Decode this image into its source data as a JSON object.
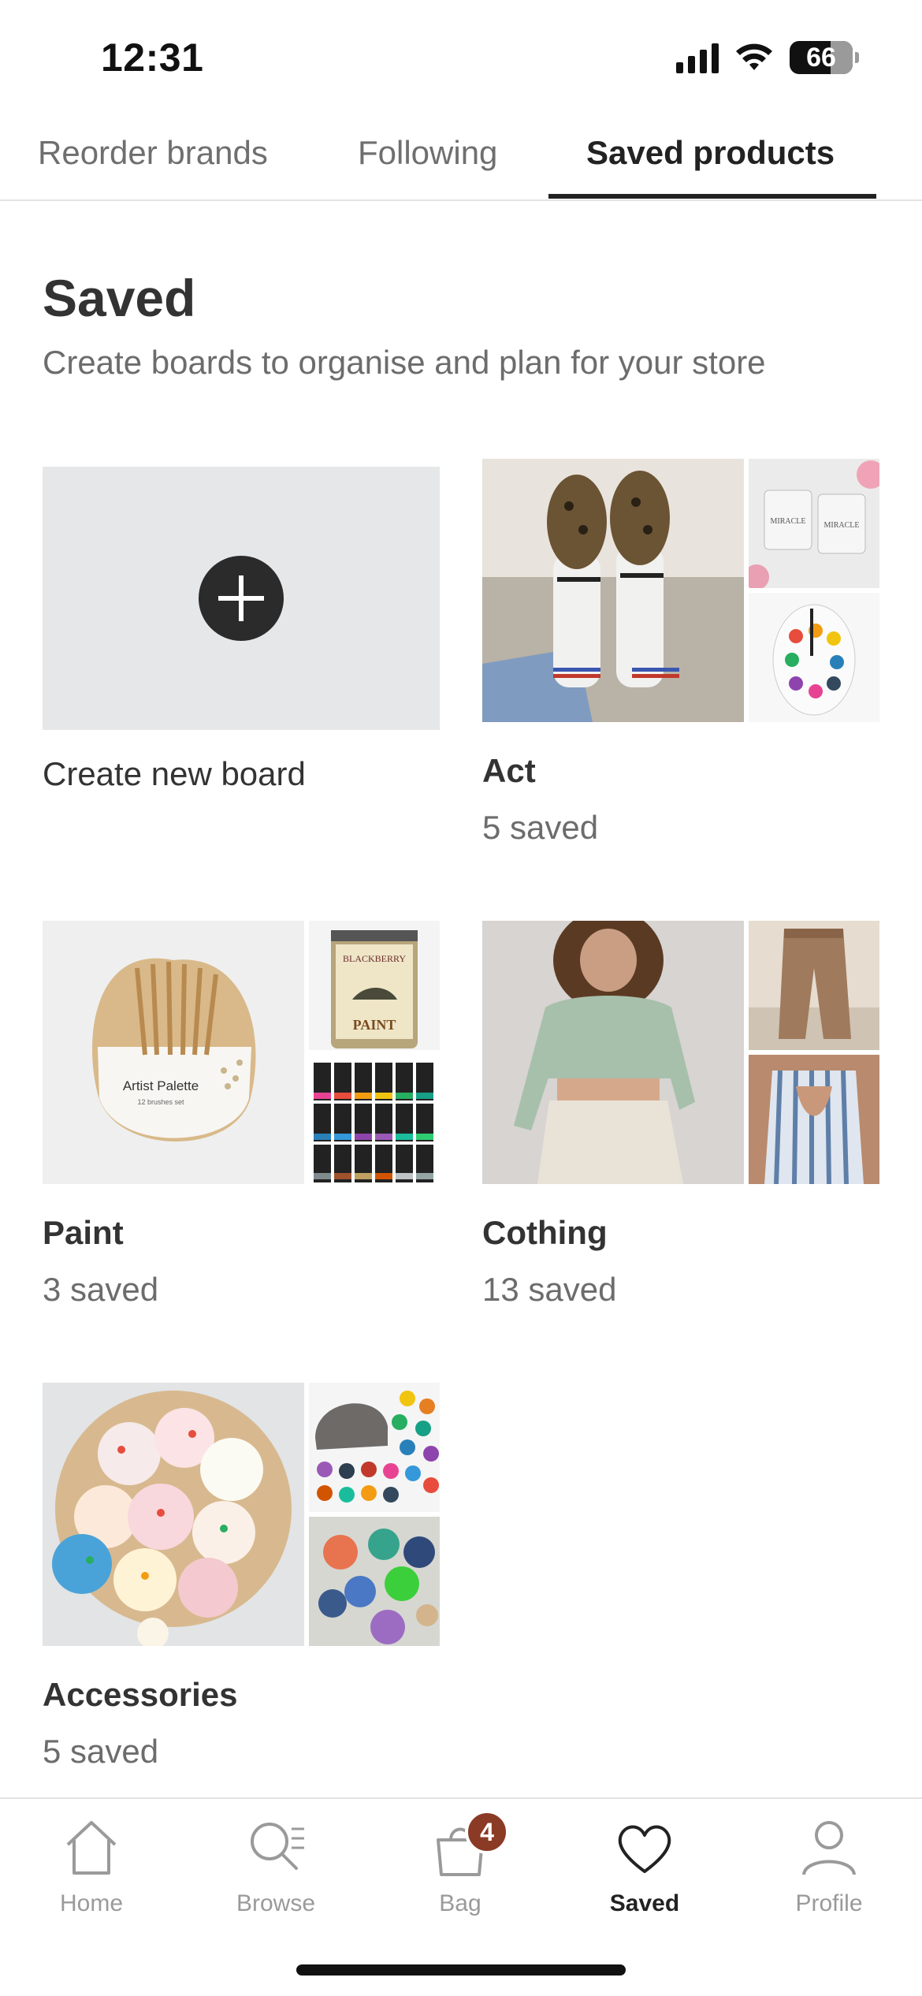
{
  "status_bar": {
    "time": "12:31",
    "battery": "66"
  },
  "tabs": [
    {
      "label": "Reorder brands"
    },
    {
      "label": "Following"
    },
    {
      "label": "Saved products",
      "active": true
    }
  ],
  "header": {
    "title": "Saved",
    "subtitle": "Create boards to organise and plan for your store"
  },
  "create_board": {
    "label": "Create new board",
    "icon": "plus-icon"
  },
  "boards": [
    {
      "name": "Act",
      "count": "5 saved"
    },
    {
      "name": "Paint",
      "count": "3 saved"
    },
    {
      "name": "Cothing",
      "count": "13 saved"
    },
    {
      "name": "Accessories",
      "count": "5 saved"
    }
  ],
  "product_image_text": {
    "palette_title": "Artist Palette",
    "palette_sub": "12 brushes set",
    "paint_can_brand": "BLACKBERRY",
    "paint_can_label": "PAINT",
    "jar_label": "MIRACLE"
  },
  "bottom_nav": {
    "items": [
      {
        "label": "Home",
        "icon": "home-icon"
      },
      {
        "label": "Browse",
        "icon": "browse-icon"
      },
      {
        "label": "Bag",
        "icon": "bag-icon",
        "badge": "4"
      },
      {
        "label": "Saved",
        "icon": "heart-icon",
        "active": true
      },
      {
        "label": "Profile",
        "icon": "profile-icon"
      }
    ]
  },
  "colors": {
    "accent": "#222222",
    "badge": "#8b3a25",
    "tile_bg": "#e6e7e9",
    "muted_text": "#6c6c6c"
  }
}
